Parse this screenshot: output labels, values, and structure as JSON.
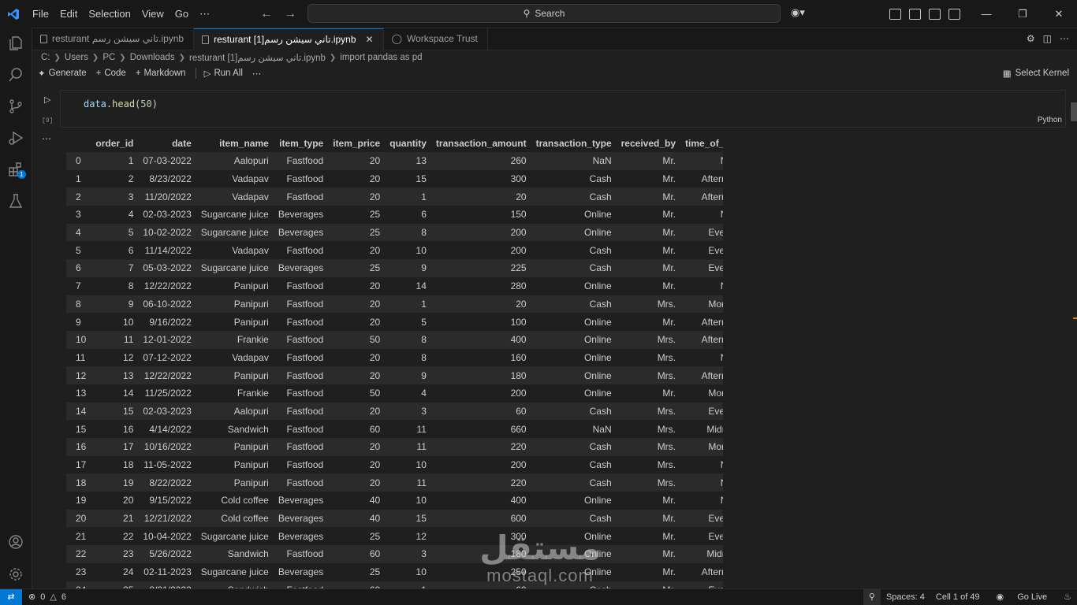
{
  "menu": [
    "File",
    "Edit",
    "Selection",
    "View",
    "Go",
    "⋯"
  ],
  "search": {
    "label": "Search"
  },
  "tabs": [
    {
      "label": "resturant تاني سيشن رسم.ipynb",
      "active": false
    },
    {
      "label": "resturant [1]تاني سيشن رسم.ipynb",
      "active": true
    },
    {
      "label": "Workspace Trust",
      "active": false
    }
  ],
  "breadcrumb": [
    "C:",
    "Users",
    "PC",
    "Downloads",
    "resturant [1]تاني سيشن رسم.ipynb",
    "import pandas as pd"
  ],
  "toolbar": {
    "generate": "Generate",
    "code": "Code",
    "markdown": "Markdown",
    "run_all": "Run All",
    "more": "⋯",
    "kernel": "Select Kernel"
  },
  "cell": {
    "var": "data",
    "fn": "head",
    "arg": "50",
    "exec_count": "[9]",
    "language": "Python",
    "output_more": "⋯"
  },
  "table": {
    "columns": [
      "",
      "order_id",
      "date",
      "item_name",
      "item_type",
      "item_price",
      "quantity",
      "transaction_amount",
      "transaction_type",
      "received_by",
      "time_of_sale"
    ],
    "rows": [
      [
        "0",
        "1",
        "07-03-2022",
        "Aalopuri",
        "Fastfood",
        "20",
        "13",
        "260",
        "NaN",
        "Mr.",
        "Night"
      ],
      [
        "1",
        "2",
        "8/23/2022",
        "Vadapav",
        "Fastfood",
        "20",
        "15",
        "300",
        "Cash",
        "Mr.",
        "Afternoon"
      ],
      [
        "2",
        "3",
        "11/20/2022",
        "Vadapav",
        "Fastfood",
        "20",
        "1",
        "20",
        "Cash",
        "Mr.",
        "Afternoon"
      ],
      [
        "3",
        "4",
        "02-03-2023",
        "Sugarcane juice",
        "Beverages",
        "25",
        "6",
        "150",
        "Online",
        "Mr.",
        "Night"
      ],
      [
        "4",
        "5",
        "10-02-2022",
        "Sugarcane juice",
        "Beverages",
        "25",
        "8",
        "200",
        "Online",
        "Mr.",
        "Evening"
      ],
      [
        "5",
        "6",
        "11/14/2022",
        "Vadapav",
        "Fastfood",
        "20",
        "10",
        "200",
        "Cash",
        "Mr.",
        "Evening"
      ],
      [
        "6",
        "7",
        "05-03-2022",
        "Sugarcane juice",
        "Beverages",
        "25",
        "9",
        "225",
        "Cash",
        "Mr.",
        "Evening"
      ],
      [
        "7",
        "8",
        "12/22/2022",
        "Panipuri",
        "Fastfood",
        "20",
        "14",
        "280",
        "Online",
        "Mr.",
        "Night"
      ],
      [
        "8",
        "9",
        "06-10-2022",
        "Panipuri",
        "Fastfood",
        "20",
        "1",
        "20",
        "Cash",
        "Mrs.",
        "Morning"
      ],
      [
        "9",
        "10",
        "9/16/2022",
        "Panipuri",
        "Fastfood",
        "20",
        "5",
        "100",
        "Online",
        "Mr.",
        "Afternoon"
      ],
      [
        "10",
        "11",
        "12-01-2022",
        "Frankie",
        "Fastfood",
        "50",
        "8",
        "400",
        "Online",
        "Mrs.",
        "Afternoon"
      ],
      [
        "11",
        "12",
        "07-12-2022",
        "Vadapav",
        "Fastfood",
        "20",
        "8",
        "160",
        "Online",
        "Mrs.",
        "Night"
      ],
      [
        "12",
        "13",
        "12/22/2022",
        "Panipuri",
        "Fastfood",
        "20",
        "9",
        "180",
        "Online",
        "Mrs.",
        "Afternoon"
      ],
      [
        "13",
        "14",
        "11/25/2022",
        "Frankie",
        "Fastfood",
        "50",
        "4",
        "200",
        "Online",
        "Mr.",
        "Morning"
      ],
      [
        "14",
        "15",
        "02-03-2023",
        "Aalopuri",
        "Fastfood",
        "20",
        "3",
        "60",
        "Cash",
        "Mrs.",
        "Evening"
      ],
      [
        "15",
        "16",
        "4/14/2022",
        "Sandwich",
        "Fastfood",
        "60",
        "11",
        "660",
        "NaN",
        "Mrs.",
        "Midnight"
      ],
      [
        "16",
        "17",
        "10/16/2022",
        "Panipuri",
        "Fastfood",
        "20",
        "11",
        "220",
        "Cash",
        "Mrs.",
        "Morning"
      ],
      [
        "17",
        "18",
        "11-05-2022",
        "Panipuri",
        "Fastfood",
        "20",
        "10",
        "200",
        "Cash",
        "Mrs.",
        "Night"
      ],
      [
        "18",
        "19",
        "8/22/2022",
        "Panipuri",
        "Fastfood",
        "20",
        "11",
        "220",
        "Cash",
        "Mrs.",
        "Night"
      ],
      [
        "19",
        "20",
        "9/15/2022",
        "Cold coffee",
        "Beverages",
        "40",
        "10",
        "400",
        "Online",
        "Mr.",
        "Night"
      ],
      [
        "20",
        "21",
        "12/21/2022",
        "Cold coffee",
        "Beverages",
        "40",
        "15",
        "600",
        "Cash",
        "Mr.",
        "Evening"
      ],
      [
        "21",
        "22",
        "10-04-2022",
        "Sugarcane juice",
        "Beverages",
        "25",
        "12",
        "300",
        "Online",
        "Mr.",
        "Evening"
      ],
      [
        "22",
        "23",
        "5/26/2022",
        "Sandwich",
        "Fastfood",
        "60",
        "3",
        "180",
        "Online",
        "Mr.",
        "Midnight"
      ],
      [
        "23",
        "24",
        "02-11-2023",
        "Sugarcane juice",
        "Beverages",
        "25",
        "10",
        "250",
        "Online",
        "Mr.",
        "Afternoon"
      ],
      [
        "24",
        "25",
        "8/31/2023",
        "Sandwich",
        "Fastfood",
        "60",
        "1",
        "60",
        "Cash",
        "Mr.",
        "Evening"
      ]
    ]
  },
  "watermark": {
    "arabic": "مستقل",
    "latin": "mostaql.com"
  },
  "status": {
    "errors": "0",
    "warnings": "6",
    "spaces": "Spaces: 4",
    "cell": "Cell 1 of 49",
    "golive": "Go Live"
  },
  "colors": {
    "accent": "#0078d4",
    "background": "#1f1f1f",
    "row_stripe": "#2b2b2b"
  }
}
